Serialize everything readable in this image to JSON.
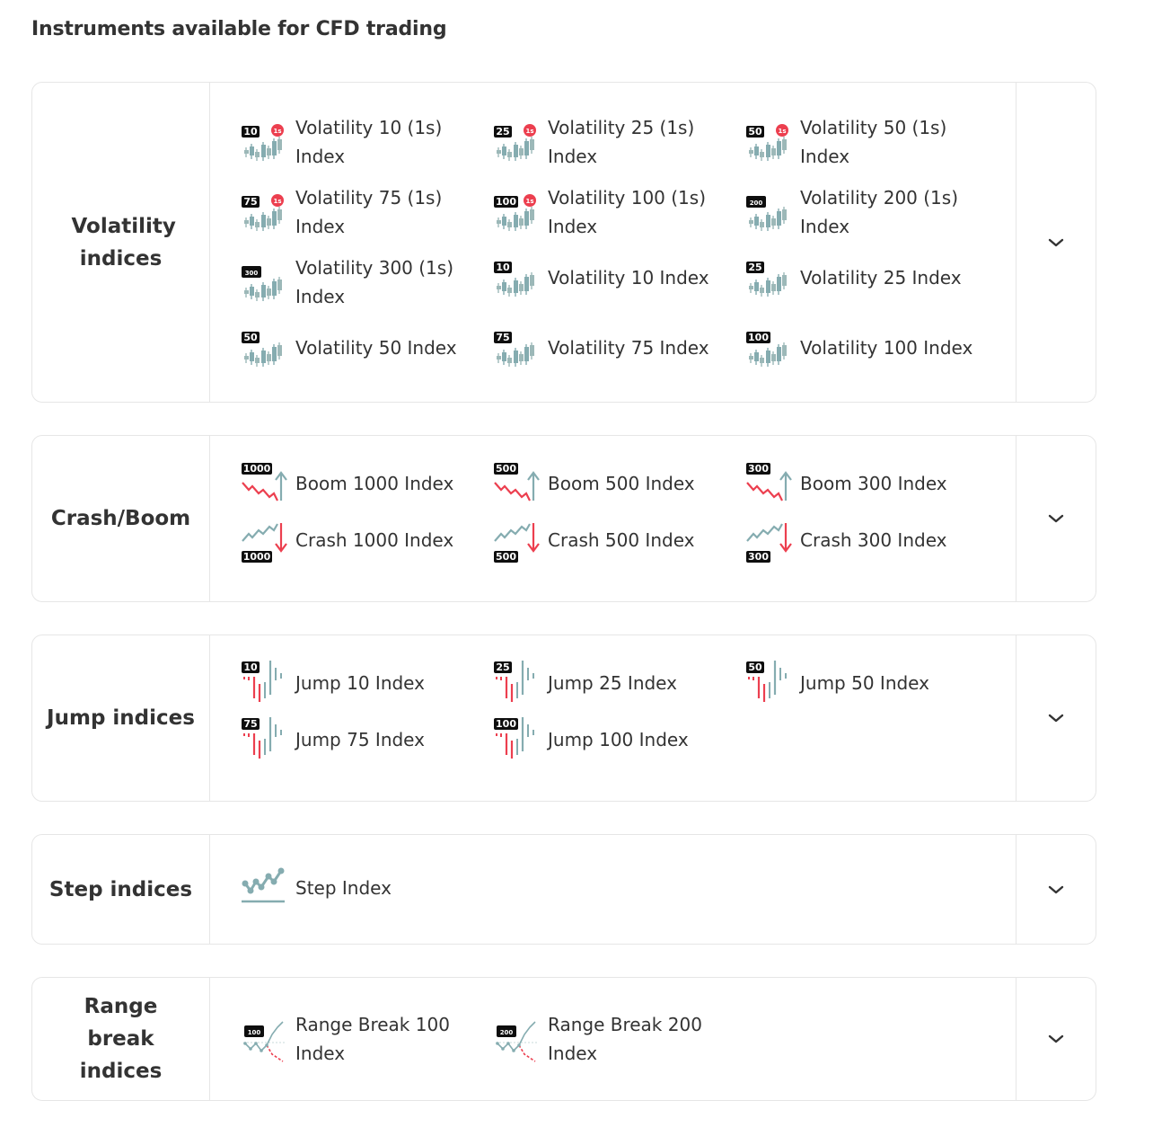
{
  "page": {
    "title": "Instruments available for CFD trading"
  },
  "colors": {
    "teal": "#85acb0",
    "red": "#ec3f4f",
    "black": "#0e0e0e",
    "border": "#e6e6e6",
    "text": "#333333"
  },
  "categories": [
    {
      "title": "Volatility indices",
      "items": [
        {
          "label": "Volatility 10 (1s) Index",
          "badge": "10",
          "one_second": "1s",
          "icon": "candlestick-icon"
        },
        {
          "label": "Volatility 25 (1s) Index",
          "badge": "25",
          "one_second": "1s",
          "icon": "candlestick-icon"
        },
        {
          "label": "Volatility 50 (1s) Index",
          "badge": "50",
          "one_second": "1s",
          "icon": "candlestick-icon"
        },
        {
          "label": "Volatility 75 (1s) Index",
          "badge": "75",
          "one_second": "1s",
          "icon": "candlestick-icon"
        },
        {
          "label": "Volatility 100 (1s) Index",
          "badge": "100",
          "one_second": "1s",
          "icon": "candlestick-icon"
        },
        {
          "label": "Volatility 200 (1s) Index",
          "badge": "200",
          "icon": "candlestick-icon"
        },
        {
          "label": "Volatility 300 (1s) Index",
          "badge": "300",
          "icon": "candlestick-icon"
        },
        {
          "label": "Volatility 10 Index",
          "badge": "10",
          "icon": "candlestick-icon"
        },
        {
          "label": "Volatility 25 Index",
          "badge": "25",
          "icon": "candlestick-icon"
        },
        {
          "label": "Volatility 50 Index",
          "badge": "50",
          "icon": "candlestick-icon"
        },
        {
          "label": "Volatility 75 Index",
          "badge": "75",
          "icon": "candlestick-icon"
        },
        {
          "label": "Volatility 100 Index",
          "badge": "100",
          "icon": "candlestick-icon"
        }
      ]
    },
    {
      "title": "Crash/Boom",
      "items": [
        {
          "label": "Boom 1000 Index",
          "badge": "1000",
          "icon": "boom-icon"
        },
        {
          "label": "Boom 500 Index",
          "badge": "500",
          "icon": "boom-icon"
        },
        {
          "label": "Boom 300 Index",
          "badge": "300",
          "icon": "boom-icon"
        },
        {
          "label": "Crash 1000 Index",
          "badge": "1000",
          "icon": "crash-icon"
        },
        {
          "label": "Crash 500 Index",
          "badge": "500",
          "icon": "crash-icon"
        },
        {
          "label": "Crash 300 Index",
          "badge": "300",
          "icon": "crash-icon"
        }
      ]
    },
    {
      "title": "Jump indices",
      "items": [
        {
          "label": "Jump 10 Index",
          "badge": "10",
          "icon": "jump-icon"
        },
        {
          "label": "Jump 25 Index",
          "badge": "25",
          "icon": "jump-icon"
        },
        {
          "label": "Jump 50 Index",
          "badge": "50",
          "icon": "jump-icon"
        },
        {
          "label": "Jump 75 Index",
          "badge": "75",
          "icon": "jump-icon"
        },
        {
          "label": "Jump 100 Index",
          "badge": "100",
          "icon": "jump-icon"
        }
      ]
    },
    {
      "title": "Step indices",
      "items": [
        {
          "label": "Step Index",
          "icon": "step-icon"
        }
      ]
    },
    {
      "title": "Range break indices",
      "items": [
        {
          "label": "Range Break 100 Index",
          "badge": "100",
          "icon": "range-break-icon"
        },
        {
          "label": "Range Break 200 Index",
          "badge": "200",
          "icon": "range-break-icon"
        }
      ]
    }
  ],
  "expand_icon": "chevron-down-icon"
}
